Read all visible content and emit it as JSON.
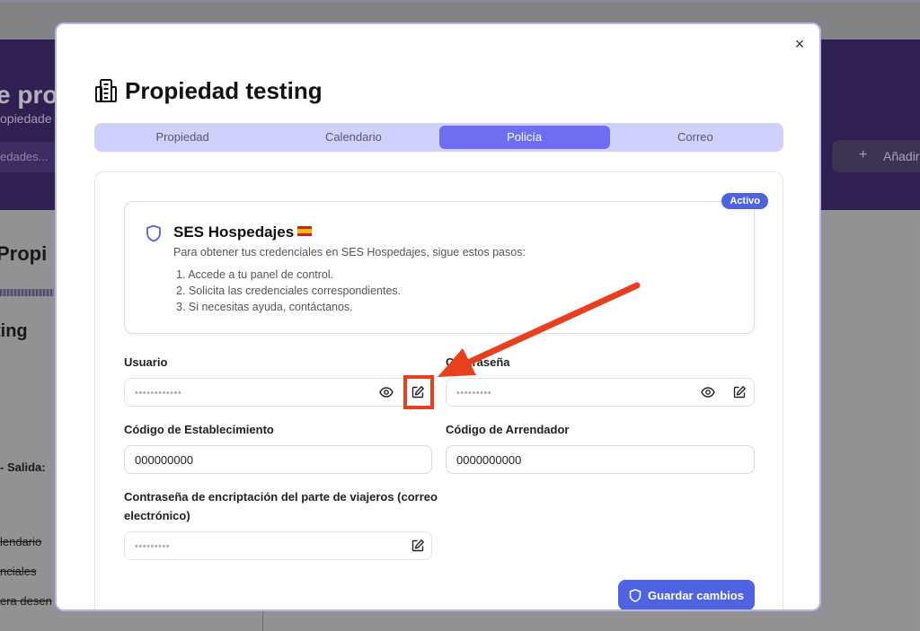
{
  "background": {
    "title": "e pro",
    "subtitle": "opiedade",
    "search_placeholder": "edades...",
    "add_button_label": "Añadir",
    "section_title": "Propi",
    "property_name": "ting",
    "row_1": "- Salida:",
    "row_2": "lendario",
    "row_3": "nciales",
    "row_4": "era desen"
  },
  "modal": {
    "title": "Propiedad testing",
    "close_label": "×",
    "tabs": [
      {
        "label": "Propiedad",
        "active": false
      },
      {
        "label": "Calendario",
        "active": false
      },
      {
        "label": "Policía",
        "active": true
      },
      {
        "label": "Correo",
        "active": false
      }
    ]
  },
  "info_card": {
    "status": "Activo",
    "title": "SES Hospedajes",
    "description": "Para obtener tus credenciales en SES Hospedajes, sigue estos pasos:",
    "steps": [
      "1. Accede a tu panel de control.",
      "2. Solicita las credenciales correspondientes.",
      "3. Si necesitas ayuda, contáctanos."
    ]
  },
  "form": {
    "usuario": {
      "label": "Usuario",
      "masked_value": "••••••••••••"
    },
    "password": {
      "label": "Contraseña",
      "masked_value": "•••••••••"
    },
    "establecimiento": {
      "label": "Código de Establecimiento",
      "value": "000000000"
    },
    "arrendador": {
      "label": "Código de Arrendador",
      "value": "0000000000"
    },
    "encryption": {
      "label_line1": "Contraseña de encriptación del parte de viajeros (correo",
      "label_line2": "electrónico)",
      "masked_value": "•••••••••"
    },
    "save_label": "Guardar cambios"
  },
  "colors": {
    "accent": "#4f63e0",
    "tab_active": "#6f6df0",
    "annotation": "#e8401f"
  }
}
